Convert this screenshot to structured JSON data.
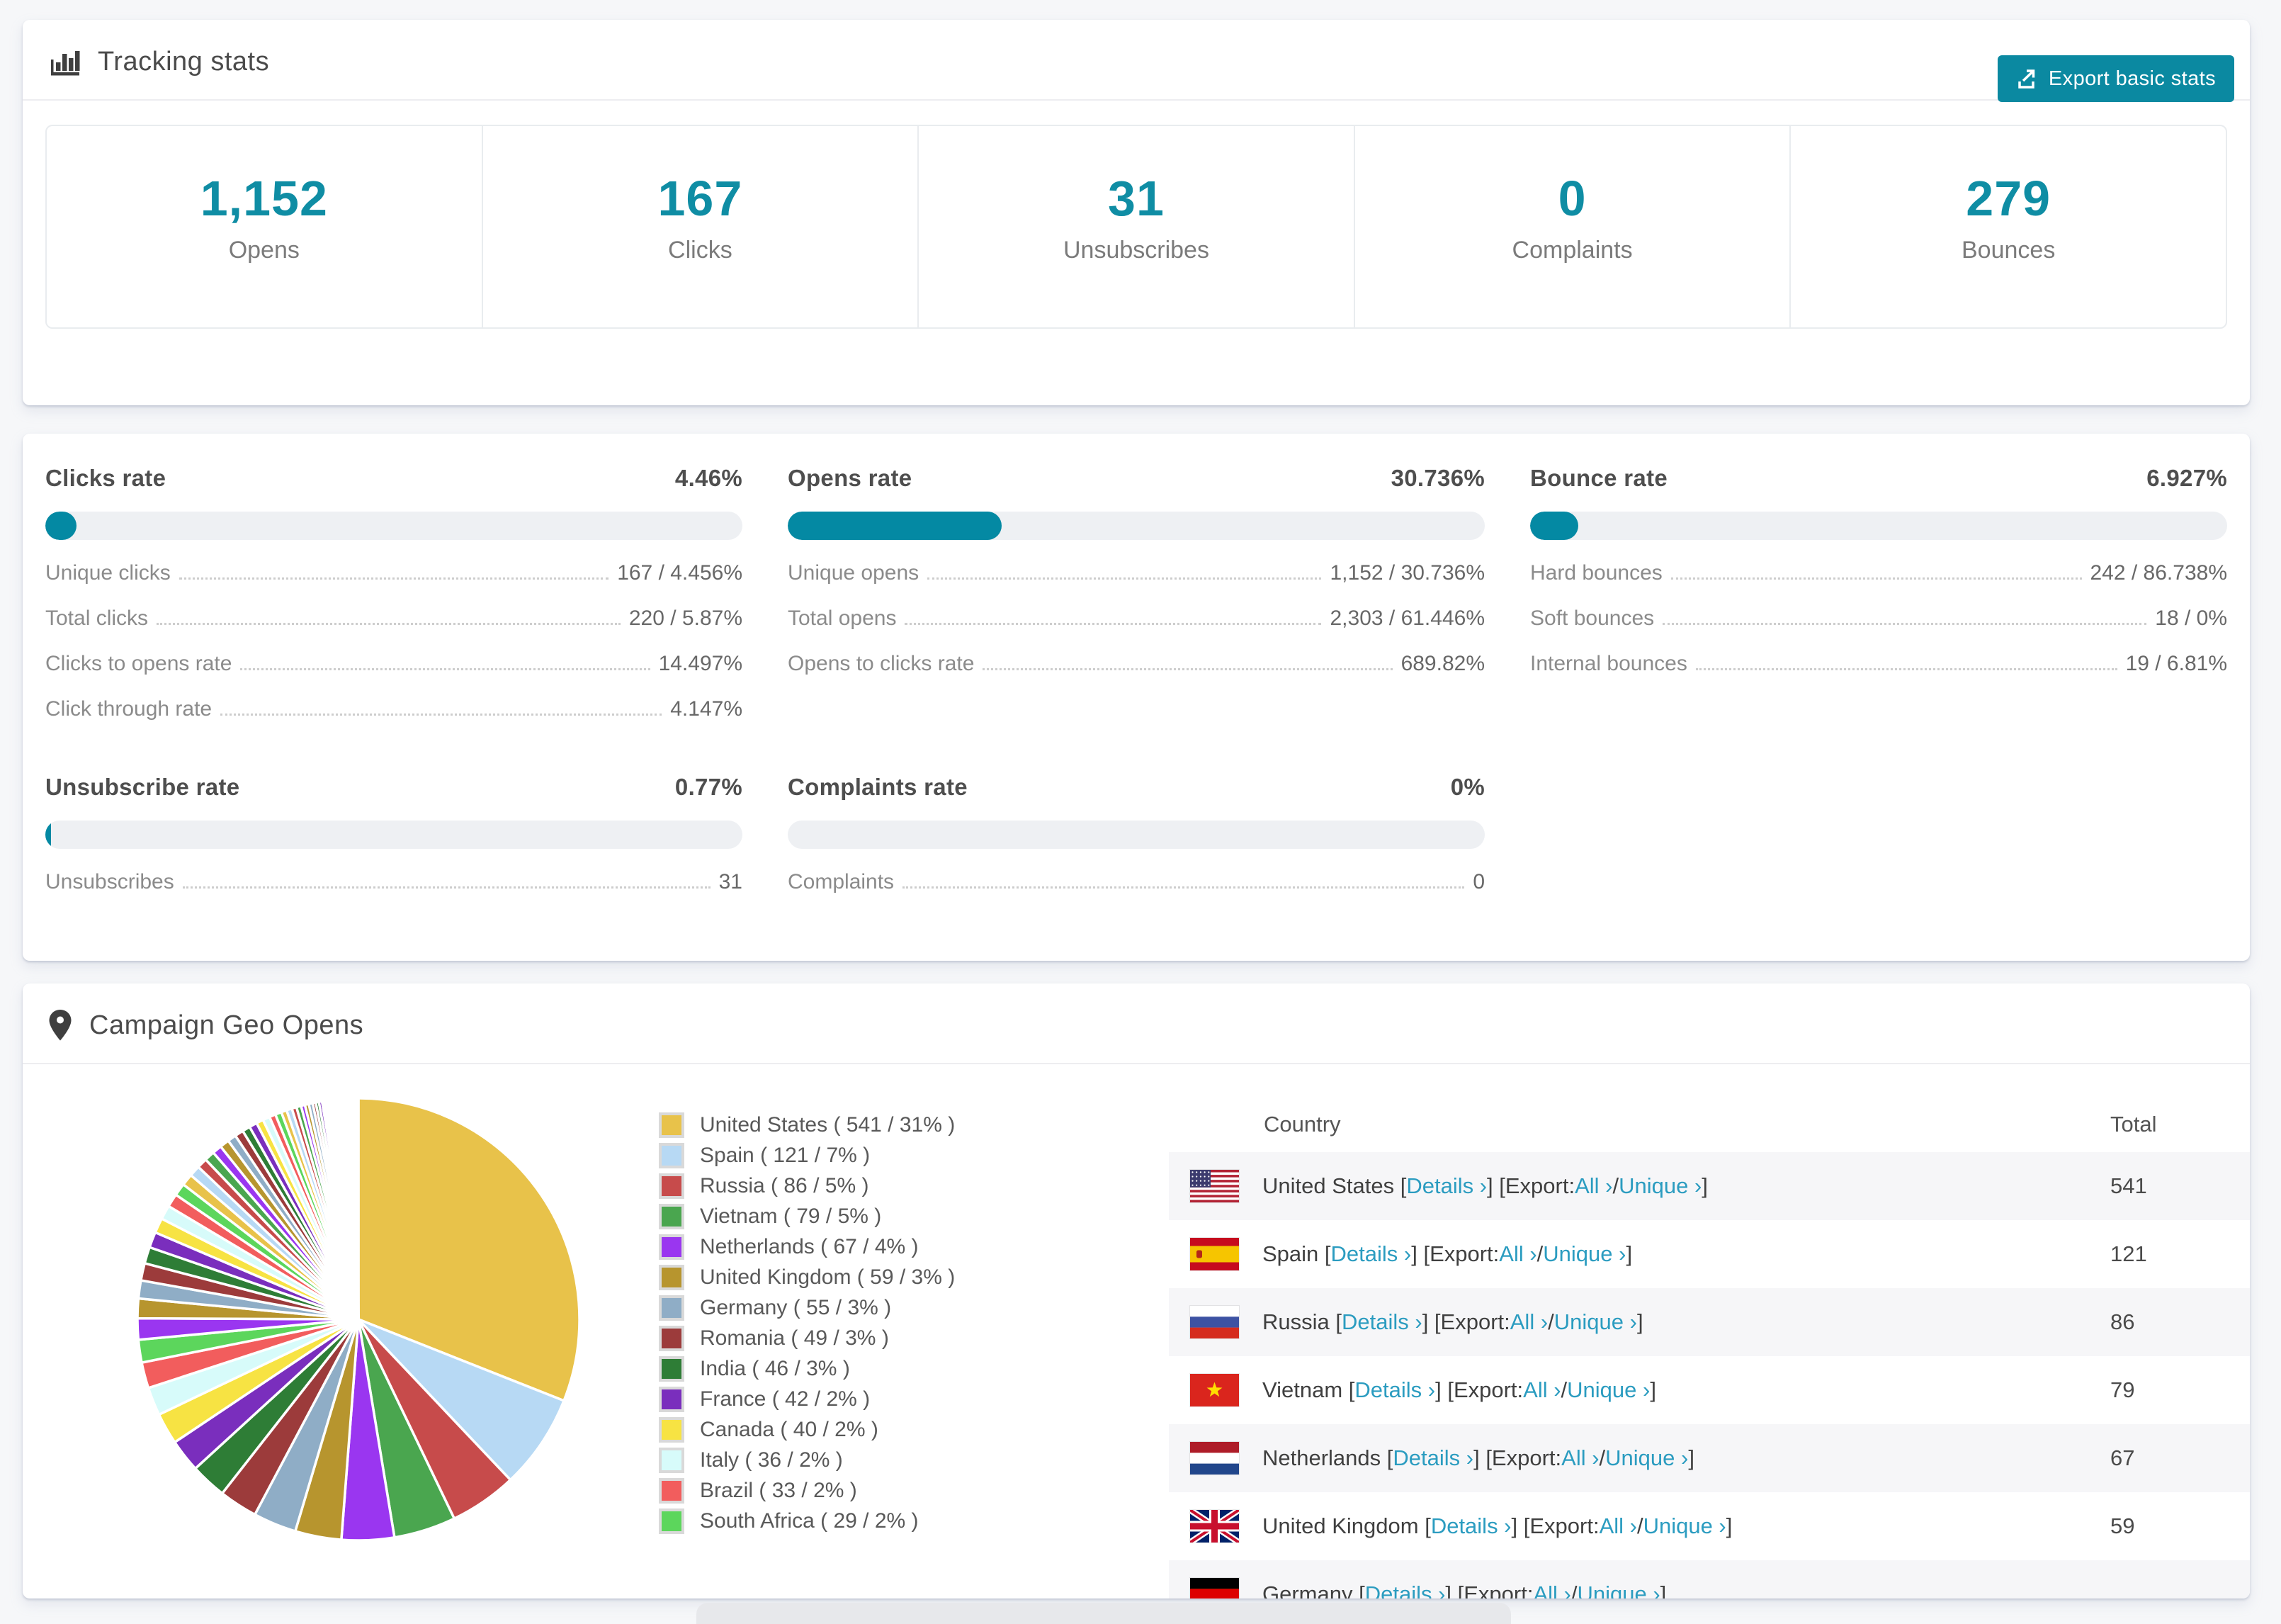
{
  "app": {
    "background": "#f6f7f9",
    "accent_teal": "#0b89a1",
    "link_color": "#2b9cc0"
  },
  "tracking": {
    "title": "Tracking stats",
    "export_button": "Export basic stats",
    "summary": [
      {
        "value": "1,152",
        "label": "Opens"
      },
      {
        "value": "167",
        "label": "Clicks"
      },
      {
        "value": "31",
        "label": "Unsubscribes"
      },
      {
        "value": "0",
        "label": "Complaints"
      },
      {
        "value": "279",
        "label": "Bounces"
      }
    ]
  },
  "rates": [
    {
      "title": "Clicks rate",
      "percent": "4.46%",
      "bar_percent": 4.46,
      "rows": [
        {
          "label": "Unique clicks",
          "value": "167 / 4.456%"
        },
        {
          "label": "Total clicks",
          "value": "220 / 5.87%"
        },
        {
          "label": "Clicks to opens rate",
          "value": "14.497%"
        },
        {
          "label": "Click through rate",
          "value": "4.147%"
        }
      ]
    },
    {
      "title": "Opens rate",
      "percent": "30.736%",
      "bar_percent": 30.736,
      "rows": [
        {
          "label": "Unique opens",
          "value": "1,152 / 30.736%"
        },
        {
          "label": "Total opens",
          "value": "2,303 / 61.446%"
        },
        {
          "label": "Opens to clicks rate",
          "value": "689.82%"
        }
      ]
    },
    {
      "title": "Bounce rate",
      "percent": "6.927%",
      "bar_percent": 6.927,
      "rows": [
        {
          "label": "Hard bounces",
          "value": "242 / 86.738%"
        },
        {
          "label": "Soft bounces",
          "value": "18 / 0%"
        },
        {
          "label": "Internal bounces",
          "value": "19 / 6.81%"
        }
      ]
    },
    {
      "title": "Unsubscribe rate",
      "percent": "0.77%",
      "bar_percent": 0.77,
      "rows": [
        {
          "label": "Unsubscribes",
          "value": "31"
        }
      ]
    },
    {
      "title": "Complaints rate",
      "percent": "0%",
      "bar_percent": 0,
      "rows": [
        {
          "label": "Complaints",
          "value": "0"
        }
      ]
    }
  ],
  "geo": {
    "title": "Campaign Geo Opens",
    "headers": {
      "country": "Country",
      "total": "Total"
    },
    "links": {
      "bracket_open": "[",
      "bracket_close": "]",
      "details": "Details",
      "export": "Export:",
      "all": "All",
      "separator": "/",
      "unique": "Unique",
      "chevron": "›"
    },
    "rows": [
      {
        "country": "United States",
        "code": "us",
        "total": "541"
      },
      {
        "country": "Spain",
        "code": "es",
        "total": "121"
      },
      {
        "country": "Russia",
        "code": "ru",
        "total": "86"
      },
      {
        "country": "Vietnam",
        "code": "vn",
        "total": "79"
      },
      {
        "country": "Netherlands",
        "code": "nl",
        "total": "67"
      },
      {
        "country": "United Kingdom",
        "code": "gb",
        "total": "59"
      },
      {
        "country": "Germany",
        "code": "de",
        "total": ""
      }
    ]
  },
  "chart_data": {
    "type": "pie",
    "title": "Campaign Geo Opens",
    "legend_position": "right",
    "start_angle_deg": 0,
    "direction": "clockwise",
    "series": [
      {
        "label": "United States",
        "value": 541,
        "percent": "31%",
        "color": "#e8c24a"
      },
      {
        "label": "Spain",
        "value": 121,
        "percent": "7%",
        "color": "#b7d9f4"
      },
      {
        "label": "Russia",
        "value": 86,
        "percent": "5%",
        "color": "#c74b4b"
      },
      {
        "label": "Vietnam",
        "value": 79,
        "percent": "5%",
        "color": "#4aa64f"
      },
      {
        "label": "Netherlands",
        "value": 67,
        "percent": "4%",
        "color": "#9a36f0"
      },
      {
        "label": "United Kingdom",
        "value": 59,
        "percent": "3%",
        "color": "#b7952e"
      },
      {
        "label": "Germany",
        "value": 55,
        "percent": "3%",
        "color": "#8fadc6"
      },
      {
        "label": "Romania",
        "value": 49,
        "percent": "3%",
        "color": "#9c3b3b"
      },
      {
        "label": "India",
        "value": 46,
        "percent": "3%",
        "color": "#2e7d36"
      },
      {
        "label": "France",
        "value": 42,
        "percent": "2%",
        "color": "#7a2ebd"
      },
      {
        "label": "Canada",
        "value": 40,
        "percent": "2%",
        "color": "#f7e343"
      },
      {
        "label": "Italy",
        "value": 36,
        "percent": "2%",
        "color": "#d7fbfa"
      },
      {
        "label": "Brazil",
        "value": 33,
        "percent": "2%",
        "color": "#f25d5d"
      },
      {
        "label": "South Africa",
        "value": 29,
        "percent": "2%",
        "color": "#5cd65c"
      }
    ],
    "others_values": [
      27,
      25,
      23,
      22,
      21,
      20,
      19,
      18,
      17,
      16,
      15,
      14,
      13,
      13,
      12,
      12,
      11,
      11,
      10,
      10,
      9,
      9,
      8,
      8,
      7,
      7,
      6,
      6,
      5,
      5,
      5,
      4,
      4,
      4,
      3,
      3,
      3,
      3,
      2,
      2,
      2,
      2,
      2,
      2,
      2,
      1,
      1,
      1,
      1,
      1,
      1,
      1,
      1,
      1,
      1,
      1,
      1,
      1,
      1,
      1,
      1,
      1,
      1,
      1,
      1
    ]
  }
}
